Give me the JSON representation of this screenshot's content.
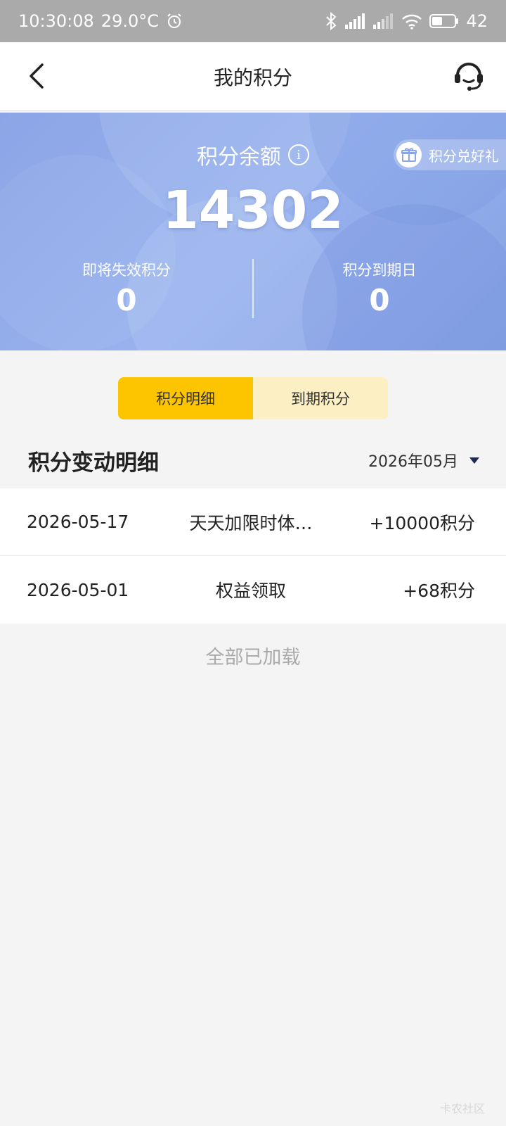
{
  "status_bar": {
    "time": "10:30:08",
    "temperature": "29.0°C",
    "battery": "42",
    "icons": [
      "alarm-icon",
      "bluetooth-icon",
      "signal-icon",
      "signal-icon",
      "wifi-icon",
      "battery-icon"
    ]
  },
  "nav": {
    "title": "我的积分",
    "back_icon": "chevron-left-icon",
    "support_icon": "headset-icon"
  },
  "balance": {
    "label": "积分余额",
    "value": "14302",
    "gift_label": "积分兑好礼",
    "expiring_label": "即将失效积分",
    "expiring_value": "0",
    "expiry_date_label": "积分到期日",
    "expiry_date_value": "0"
  },
  "tabs": [
    {
      "label": "积分明细",
      "active": true
    },
    {
      "label": "到期积分",
      "active": false
    }
  ],
  "section": {
    "title": "积分变动明细",
    "month": "2026年05月"
  },
  "records": [
    {
      "date": "2026-05-17",
      "desc": "天天加限时体…",
      "amount": "+10000积分"
    },
    {
      "date": "2026-05-01",
      "desc": "权益领取",
      "amount": "+68积分"
    }
  ],
  "footer": {
    "all_loaded": "全部已加载",
    "watermark": "卡农社区"
  },
  "colors": {
    "accent": "#fcc500",
    "tab_inactive": "#fdefc4",
    "panel": "#8ba5e6"
  }
}
